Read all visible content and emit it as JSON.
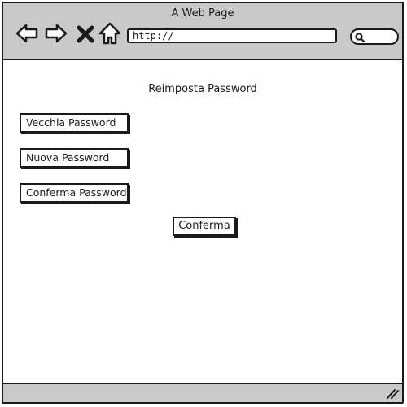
{
  "window": {
    "title": "A Web Page"
  },
  "toolbar": {
    "url": "http://",
    "icons": [
      "back-arrow-icon",
      "forward-arrow-icon",
      "close-x-icon",
      "home-icon",
      "search-icon"
    ]
  },
  "form": {
    "heading": "Reimposta Password",
    "old_password": "Vecchia Password",
    "new_password": "Nuova Password",
    "confirm_password": "Conferma Password",
    "confirm_button": "Conferma"
  },
  "colors": {
    "chrome": "#c9c9c9",
    "ink": "#1a1a1a",
    "page": "#ffffff"
  }
}
